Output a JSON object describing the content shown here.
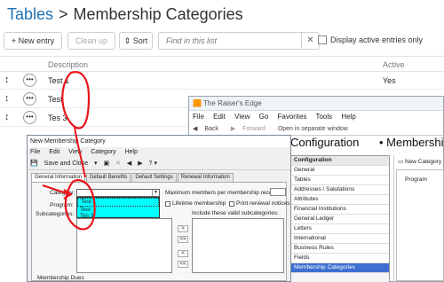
{
  "breadcrumb": {
    "parent": "Tables",
    "separator": ">",
    "current": "Membership Categories"
  },
  "toolbar": {
    "new_entry": "+ New entry",
    "clean_up": "Clean up",
    "sort": "⇕ Sort",
    "search_placeholder": "Find in this list",
    "clear": "✕",
    "active_only": "Display active entries only"
  },
  "table": {
    "columns": [
      "Description",
      "Active"
    ],
    "rows": [
      {
        "description": "Test 1",
        "active": "Yes"
      },
      {
        "description": "Test",
        "active": ""
      },
      {
        "description": "Tes 3",
        "active": ""
      }
    ]
  },
  "ie_window": {
    "title": "The Raiser's Edge",
    "menu": [
      "File",
      "Edit",
      "View",
      "Go",
      "Favorites",
      "Tools",
      "Help"
    ],
    "nav": [
      "Back",
      "Forward",
      "Open in separate window"
    ],
    "config_title": "Configuration",
    "config_title2": "• Membership",
    "new_category": "New Category",
    "program": "Program",
    "nav_items": [
      "Configuration",
      "General",
      "Tables",
      "Addresses / Salutations",
      "Attributes",
      "Financial Institutions",
      "General Ledger",
      "Letters",
      "International",
      "Business Rules",
      "Fields",
      "Membership Categories"
    ]
  },
  "dialog": {
    "title": "New Membership Category",
    "menu": [
      "File",
      "Edit",
      "View",
      "Category",
      "Help"
    ],
    "save_close": "Save and Close",
    "tabs": [
      "General Information",
      "Default Benefits",
      "Default Settings",
      "Renewal Information"
    ],
    "category_label": "Category:",
    "program_label": "Program:",
    "subcategories_label": "Subcategories:",
    "category_options": [
      "Test 1",
      "Test",
      "Tes 3"
    ],
    "max_members": "Maximum members per membership record:",
    "lifetime": "Lifetime membership",
    "print_renewal": "Print renewal notices",
    "include_valid": "Include these valid subcategories:",
    "membership_dues": "Membership Dues"
  },
  "colors": {
    "link": "#1f73b7",
    "highlight": "#00ffff",
    "annotation": "#e8141b",
    "selection": "#3c6fd1"
  }
}
